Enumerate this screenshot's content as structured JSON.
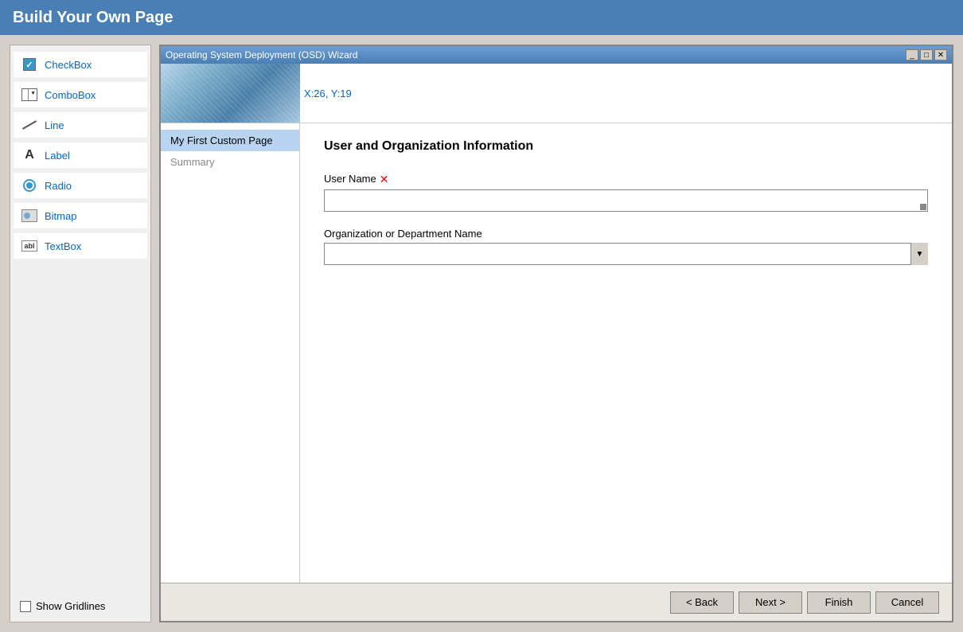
{
  "page": {
    "title": "Build Your Own Page"
  },
  "toolbox": {
    "items": [
      {
        "id": "checkbox",
        "label": "CheckBox",
        "icon": "checkbox-icon"
      },
      {
        "id": "combobox",
        "label": "ComboBox",
        "icon": "combobox-icon"
      },
      {
        "id": "line",
        "label": "Line",
        "icon": "line-icon"
      },
      {
        "id": "label",
        "label": "Label",
        "icon": "label-icon"
      },
      {
        "id": "radio",
        "label": "Radio",
        "icon": "radio-icon"
      },
      {
        "id": "bitmap",
        "label": "Bitmap",
        "icon": "bitmap-icon"
      },
      {
        "id": "textbox",
        "label": "TextBox",
        "icon": "textbox-icon"
      }
    ],
    "show_gridlines_label": "Show Gridlines"
  },
  "wizard": {
    "title": "Operating System Deployment (OSD) Wizard",
    "coords": "X:26, Y:19",
    "nav_items": [
      {
        "id": "custom-page",
        "label": "My First Custom Page",
        "active": true
      },
      {
        "id": "summary",
        "label": "Summary",
        "active": false
      }
    ],
    "section_title": "User and Organization Information",
    "fields": [
      {
        "id": "user-name",
        "label": "User Name",
        "type": "text",
        "required": true,
        "value": ""
      },
      {
        "id": "org-name",
        "label": "Organization or Department Name",
        "type": "combo",
        "required": false,
        "value": ""
      }
    ],
    "buttons": {
      "back": "< Back",
      "next": "Next >",
      "finish": "Finish",
      "cancel": "Cancel"
    }
  }
}
